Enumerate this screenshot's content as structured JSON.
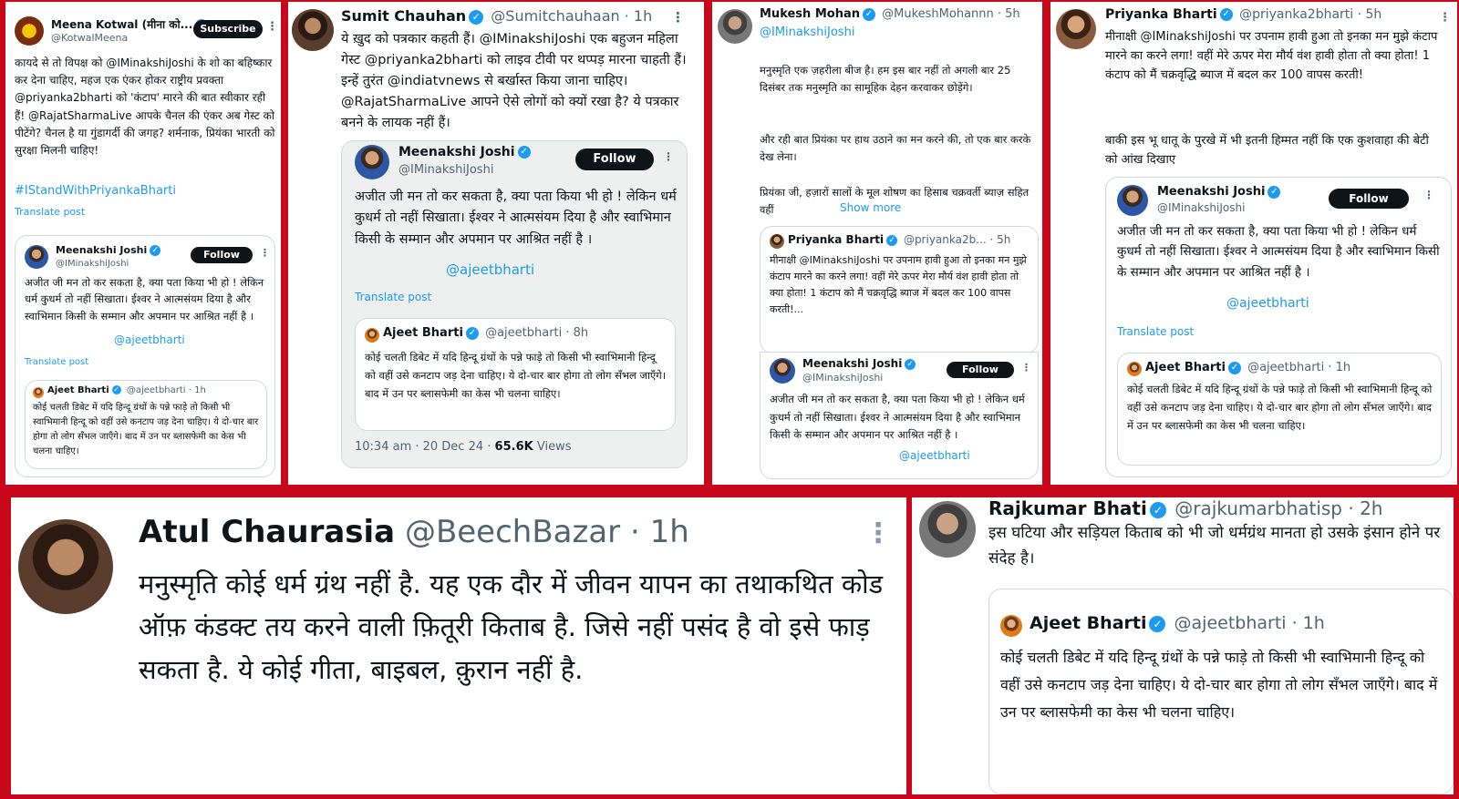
{
  "p1": {
    "name": "Meena Kotwal (मीना को...",
    "handle": "@KotwalMeena",
    "subscribe": "Subscribe",
    "text": "कायदे से तो विपक्ष को @IMinakshiJoshi के शो का बहिष्कार कर देना चाहिए, महज एक एंकर होकर राष्ट्रीय प्रवक्ता @priyanka2bharti को 'कंटाप' मारने की बात स्वीकार रही हैं! @RajatSharmaLive आपके चैनल की एंकर अब गेस्ट को पीटेंगे? चैनल है या गुंडागर्दी की जगह? शर्मनाक, प्रियंका भारती को सुरक्षा मिलनी चाहिए!",
    "hashtag": "#IStandWithPriyankaBharti",
    "translate": "Translate post",
    "quote": {
      "name": "Meenakshi Joshi",
      "handle": "@IMinakshiJoshi",
      "follow": "Follow",
      "text": "अजीत जी मन तो कर सकता है, क्या पता किया भी हो ! लेकिन धर्म कुधर्म तो नहीं सिखाता। ईश्वर ने आत्मसंयम दिया है और स्वाभिमान किसी के सम्मान और अपमान पर आश्रित नहीं है ।",
      "mention": "@ajeetbharti",
      "translate": "Translate post",
      "inner": {
        "name": "Ajeet Bharti",
        "handle": "@ajeetbharti",
        "time": "· 1h",
        "text": "कोई चलती डिबेट में यदि हिन्दू ग्रंथों के पन्ने फाड़े तो किसी भी स्वाभिमानी हिन्दू को वहीं उसे कनटाप जड़ देना चाहिए। ये दो-चार बार होगा तो लोग सँभल जाएँगे। बाद में उन पर ब्लासफेमी का केस भी चलना चाहिए।"
      }
    }
  },
  "p2": {
    "name": "Sumit Chauhan",
    "handle": "@Sumitchauhaan",
    "time": "· 1h",
    "text": "ये ख़ुद को पत्रकार कहती हैं। @IMinakshiJoshi एक बहुजन महिला गेस्ट @priyanka2bharti को लाइव टीवी पर थप्पड़ मारना चाहती हैं। इन्हें तुरंत @indiatvnews से बर्खास्त किया जाना चाहिए। @RajatSharmaLive आपने ऐसे लोगों को क्यों रखा है? ये पत्रकार बनने के लायक नहीं हैं।",
    "quote": {
      "name": "Meenakshi Joshi",
      "handle": "@IMinakshiJoshi",
      "follow": "Follow",
      "text": "अजीत जी मन तो कर सकता है, क्या पता किया भी हो ! लेकिन धर्म कुधर्म तो नहीं सिखाता। ईश्वर ने आत्मसंयम दिया है और स्वाभिमान किसी के सम्मान और अपमान पर आश्रित नहीं है ।",
      "mention": "@ajeetbharti",
      "translate": "Translate post",
      "inner": {
        "name": "Ajeet Bharti",
        "handle": "@ajeetbharti",
        "time": "· 8h",
        "text": "कोई चलती डिबेट में यदि हिन्दू ग्रंथों के पन्ने फाड़े तो किसी भी स्वाभिमानी हिन्दू को वहीं उसे कनटाप जड़ देना चाहिए। ये दो-चार बार होगा तो लोग सँभल जाएँगे। बाद में उन पर ब्लासफेमी का केस भी चलना चाहिए।"
      },
      "timestamp": "10:34 am · 20 Dec 24 ·",
      "views_count": "65.6K",
      "views_label": "Views"
    }
  },
  "p3": {
    "name": "Mukesh Mohan",
    "handle": "@MukeshMohannn",
    "time": "· 5h",
    "reply_to": "@IMinakshiJoshi",
    "text1": "मनुस्मृति एक ज़हरीला बीज है। हम इस बार नहीं तो अगली बार 25 दिसंबर तक मनुस्मृति का सामूहिक देहन करवाकर छोड़ेंगे।",
    "text2": "और रही बात प्रियंका पर हाथ उठाने का मन करने की, तो एक बार करके देख लेना।",
    "text3": "प्रियंका जी, हज़ारों सालों के मूल शोषण का हिसाब चक्रवर्ती ब्याज़ सहित वहीं",
    "show_more": "Show more",
    "quote1": {
      "name": "Priyanka Bharti",
      "handle": "@priyanka2b...",
      "time": "· 5h",
      "text": "मीनाक्षी @IMinakshiJoshi पर उपनाम हावी हुआ तो इनका मन मुझे कंटाप मारने का करने लगा! वहीं मेरे ऊपर मेरा मौर्य वंश हावी होता तो क्या होता! 1 कंटाप को मैं चक्रवृद्धि ब्याज में बदल कर 100 वापस करती!..."
    },
    "quote2": {
      "name": "Meenakshi Joshi",
      "handle": "@IMinakshiJoshi",
      "follow": "Follow",
      "text": "अजीत जी मन तो कर सकता है, क्या पता किया भी हो ! लेकिन धर्म कुधर्म तो नहीं सिखाता। ईश्वर ने आत्मसंयम दिया है और स्वाभिमान किसी के सम्मान और अपमान पर आश्रित नहीं है ।",
      "mention": "@ajeetbharti"
    }
  },
  "p4": {
    "name": "Priyanka Bharti",
    "handle": "@priyanka2bharti",
    "time": "· 5h",
    "text1": "मीनाक्षी @IMinakshiJoshi पर उपनाम हावी हुआ तो इनका मन मुझे कंटाप मारने का करने लगा! वहीं मेरे ऊपर मेरा मौर्य वंश हावी होता तो क्या होता! 1 कंटाप को मैं चक्रवृद्धि ब्याज में बदल कर 100 वापस करती!",
    "text2": "बाकी इस भू धातू के पुरखे में भी इतनी हिम्मत नहीं कि एक कुशवाहा की बेटी को आंख दिखाए",
    "quote": {
      "name": "Meenakshi Joshi",
      "handle": "@IMinakshiJoshi",
      "follow": "Follow",
      "text": "अजीत जी मन तो कर सकता है, क्या पता किया भी हो ! लेकिन धर्म कुधर्म तो नहीं सिखाता। ईश्वर ने आत्मसंयम दिया है और स्वाभिमान किसी के सम्मान और अपमान पर आश्रित नहीं है ।",
      "mention": "@ajeetbharti",
      "translate": "Translate post",
      "inner": {
        "name": "Ajeet Bharti",
        "handle": "@ajeetbharti",
        "time": "· 1h",
        "text": "कोई चलती डिबेट में यदि हिन्दू ग्रंथों के पन्ने फाड़े तो किसी भी स्वाभिमानी हिन्दू को वहीं उसे कनटाप जड़ देना चाहिए। ये दो-चार बार होगा तो लोग सँभल जाएँगे। बाद में उन पर ब्लासफेमी का केस भी चलना चाहिए।"
      }
    }
  },
  "p5": {
    "name": "Atul Chaurasia",
    "handle": "@BeechBazar",
    "time": "· 1h",
    "text": "मनुस्मृति कोई धर्म ग्रंथ नहीं है. यह एक दौर में जीवन यापन का तथाकथित कोड ऑफ़ कंडक्ट तय करने वाली फ़ितूरी किताब है. जिसे नहीं पसंद है वो इसे फाड़ सकता है. ये कोई गीता, बाइबल, क़ुरान नहीं है."
  },
  "p6": {
    "name": "Rajkumar Bhati",
    "handle": "@rajkumarbhatisp",
    "time": "· 2h",
    "text": "इस घटिया और सड़ियल किताब को भी जो धर्मग्रंथ मानता हो उसके इंसान होने पर संदेह है।",
    "quote": {
      "name": "Ajeet Bharti",
      "handle": "@ajeetbharti",
      "time": "· 1h",
      "text": "कोई चलती डिबेट में यदि हिन्दू ग्रंथों के पन्ने फाड़े तो किसी भी स्वाभिमानी हिन्दू को वहीं उसे कनटाप जड़ देना चाहिए। ये दो-चार बार होगा तो लोग सँभल जाएँगे। बाद में उन पर ब्लासफेमी का केस भी चलना चाहिए।"
    }
  },
  "icons": {
    "verified": "✓",
    "more": "⋮"
  }
}
